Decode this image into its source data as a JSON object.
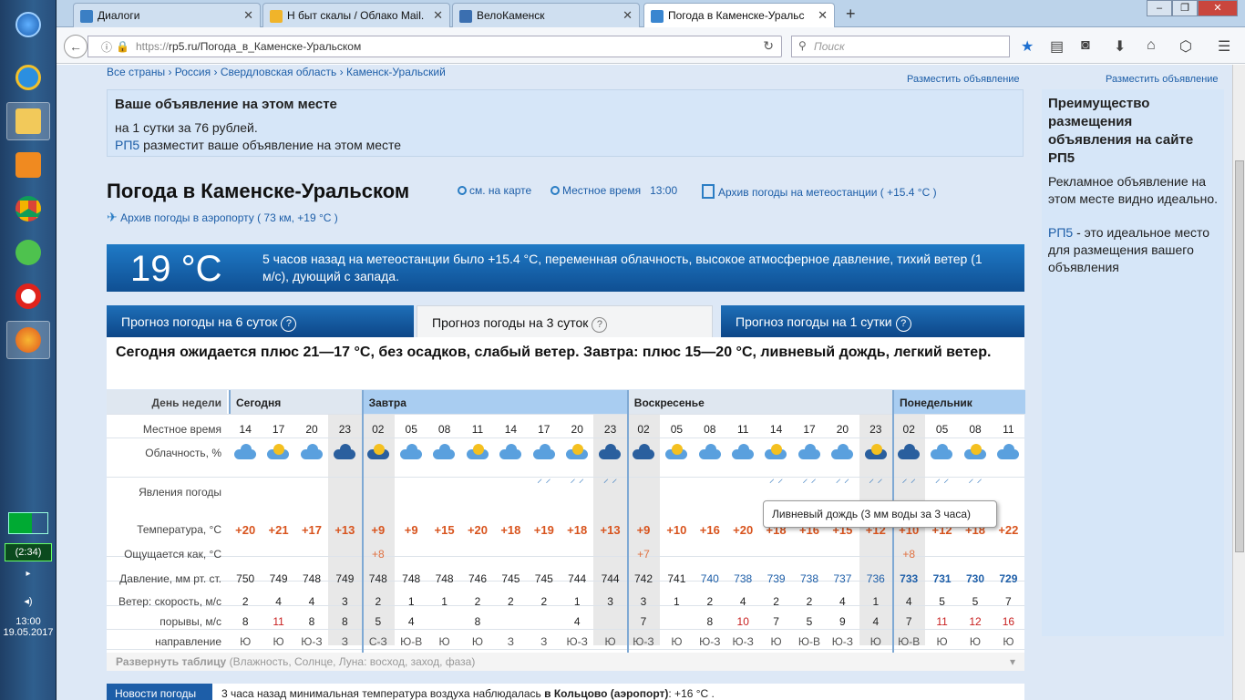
{
  "taskbar": {
    "clock_time": "13:00",
    "clock_date": "19.05.2017",
    "battery": "(2:34)"
  },
  "browser": {
    "tabs": [
      {
        "label": "Диалоги",
        "fav": "#3b7fc4"
      },
      {
        "label": "Н быт скалы / Облако Mail.",
        "fav": "#f0b42a"
      },
      {
        "label": "ВелоКаменск",
        "fav": "#3b6fb0"
      },
      {
        "label": "Погода в Каменске-Уральс",
        "fav": "#3a86d0"
      }
    ],
    "new_tab": "+",
    "url_protocol": "https://",
    "url_rest": "rp5.ru/Погода_в_Каменске-Уральском",
    "search_placeholder": "Поиск"
  },
  "page": {
    "crumbs": [
      "Все страны",
      "Россия",
      "Свердловская область",
      "Каменск-Уральский"
    ],
    "ad_link": "Разместить объявление",
    "ad_top": {
      "title": "Ваше объявление на этом месте",
      "line1": "на 1 сутки за 76 рублей.",
      "line2_link": "РП5",
      "line2_text": " разместит ваше объявление на этом месте"
    },
    "title": "Погода в Каменске-Уральском",
    "map_link": "см. на карте",
    "local_time_label": "Местное время",
    "local_time": "13:00",
    "archive_station": "Архив погоды на метеостанции ( +15.4 °C )",
    "archive_airport": "Архив погоды в аэропорту ( 73 км, +19 °C )",
    "now_temp": "19 °C",
    "now_desc": "5 часов назад на метеостанции было +15.4 °C, переменная облачность, высокое атмосферное давление, тихий ветер (1 м/с), дующий с запада.",
    "tabs": [
      "Прогноз погоды на 6 суток",
      "Прогноз погоды на 3 суток",
      "Прогноз погоды на 1 сутки"
    ],
    "summary": "Сегодня ожидается плюс 21—17 °C, без осадков, слабый ветер. Завтра: плюс 15—20 °C, ливневый дождь, легкий ветер.",
    "row_labels": {
      "day": "День недели",
      "time": "Местное время",
      "cloud": "Облачность, %",
      "phen": "Явления погоды",
      "temp": "Температура, °C",
      "feels": "Ощущается как, °C",
      "press": "Давление, мм рт. ст.",
      "wind": "Ветер: скорость, м/с",
      "gust": "порывы, м/с",
      "dir": "направление"
    },
    "days": [
      "Сегодня",
      "Завтра",
      "Воскресенье",
      "Понедельник"
    ],
    "times": [
      "14",
      "17",
      "20",
      "23",
      "02",
      "05",
      "08",
      "11",
      "14",
      "17",
      "20",
      "23",
      "02",
      "05",
      "08",
      "11",
      "14",
      "17",
      "20",
      "23",
      "02",
      "05",
      "08",
      "11"
    ],
    "temps": [
      "+20",
      "+21",
      "+17",
      "+13",
      "+9",
      "+9",
      "+15",
      "+20",
      "+18",
      "+19",
      "+18",
      "+13",
      "+9",
      "+10",
      "+16",
      "+20",
      "+18",
      "+16",
      "+15",
      "+12",
      "+10",
      "+12",
      "+18",
      "+22"
    ],
    "feels": [
      "",
      "",
      "",
      "",
      "+8",
      "",
      "",
      "",
      "",
      "",
      "",
      "",
      "+7",
      "",
      "",
      "",
      "",
      "",
      "",
      "",
      "+8",
      "",
      "",
      ""
    ],
    "pressure": [
      "750",
      "749",
      "748",
      "749",
      "748",
      "748",
      "748",
      "746",
      "745",
      "745",
      "744",
      "744",
      "742",
      "741",
      "740",
      "738",
      "739",
      "738",
      "737",
      "736",
      "733",
      "731",
      "730",
      "729"
    ],
    "wind": [
      "2",
      "4",
      "4",
      "3",
      "2",
      "1",
      "1",
      "2",
      "2",
      "2",
      "1",
      "3",
      "3",
      "1",
      "2",
      "4",
      "2",
      "2",
      "4",
      "1",
      "4",
      "5",
      "5",
      "7"
    ],
    "gust": [
      "8",
      "11",
      "8",
      "8",
      "5",
      "4",
      "",
      "8",
      "",
      "",
      "4",
      "",
      "7",
      "",
      "8",
      "10",
      "7",
      "5",
      "9",
      "4",
      "7",
      "11",
      "12",
      "16"
    ],
    "dir": [
      "Ю",
      "Ю",
      "Ю-З",
      "З",
      "С-З",
      "Ю-В",
      "Ю",
      "Ю",
      "З",
      "З",
      "Ю-З",
      "Ю",
      "Ю-З",
      "Ю",
      "Ю-З",
      "Ю-З",
      "Ю",
      "Ю-В",
      "Ю-З",
      "Ю",
      "Ю-В",
      "Ю",
      "Ю",
      "Ю"
    ],
    "tooltip": "Ливневый дождь (3 мм воды за 3 часа)",
    "expand": "Развернуть таблицу",
    "expand_hint": "(Влажность, Солнце, Луна: восход, заход, фаза)",
    "news_label": "Новости погоды",
    "news_text": "3 часа назад минимальная температура воздуха наблюдалась ",
    "news_place": "в Кольцово (аэропорт)",
    "news_val": ": +16 °C ."
  },
  "side_ad": {
    "title": "Преимущество размещения объявления на сайте РП5",
    "p1": "Рекламное объявление на этом месте видно идеально.",
    "p2_link": "РП5",
    "p2": " - это идеальное место для размещения вашего объявления"
  }
}
